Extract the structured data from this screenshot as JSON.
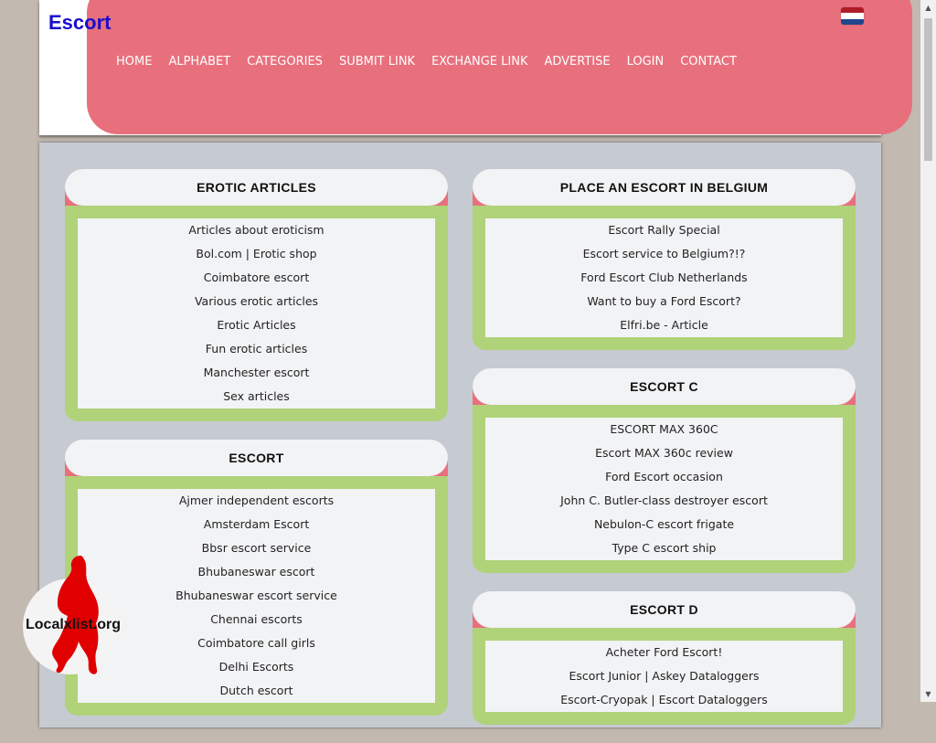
{
  "header": {
    "site_title": "Escort",
    "nav": [
      "HOME",
      "ALPHABET",
      "CATEGORIES",
      "SUBMIT LINK",
      "EXCHANGE LINK",
      "ADVERTISE",
      "LOGIN",
      "CONTACT"
    ],
    "flag_colors": [
      "#ae1c28",
      "#ffffff",
      "#21468b"
    ]
  },
  "left_column": [
    {
      "title": "EROTIC ARTICLES",
      "links": [
        "Articles about eroticism",
        "Bol.com | Erotic shop",
        "Coimbatore escort",
        "Various erotic articles",
        "Erotic Articles",
        "Fun erotic articles",
        "Manchester escort",
        "Sex articles"
      ]
    },
    {
      "title": "ESCORT",
      "links": [
        "Ajmer independent escorts",
        "Amsterdam Escort",
        "Bbsr escort service",
        "Bhubaneswar escort",
        "Bhubaneswar escort service",
        "Chennai escorts",
        "Coimbatore call girls",
        "Delhi Escorts",
        "Dutch escort"
      ]
    }
  ],
  "right_column": [
    {
      "title": "PLACE AN ESCORT IN BELGIUM",
      "links": [
        "Escort Rally Special",
        "Escort service to Belgium?!?",
        "Ford Escort Club Netherlands",
        "Want to buy a Ford Escort?",
        "Elfri.be - Article"
      ]
    },
    {
      "title": "ESCORT C",
      "links": [
        "ESCORT MAX 360C",
        "Escort MAX 360c review",
        "Ford Escort occasion",
        "John C. Butler-class destroyer escort",
        "Nebulon-C escort frigate",
        "Type C escort ship"
      ]
    },
    {
      "title": "ESCORT D",
      "links": [
        "Acheter Ford Escort!",
        "Escort Junior | Askey Dataloggers",
        "Escort-Cryopak | Escort Dataloggers"
      ]
    }
  ],
  "watermark": {
    "text": "Localxlist.org",
    "icon": "silhouette-icon",
    "color": "#e00000"
  },
  "colors": {
    "header_pink": "#e8707c",
    "block_green": "#b0d279",
    "panel_gray": "#c6cad1",
    "title_blue": "#1a0dcc"
  }
}
